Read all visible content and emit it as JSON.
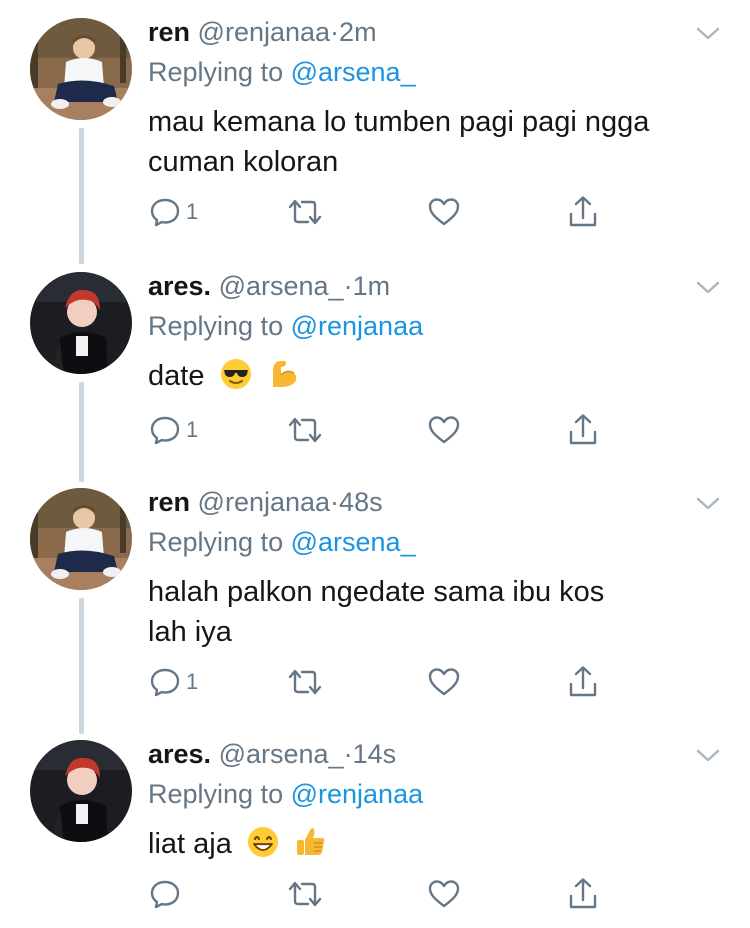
{
  "tweets": [
    {
      "name": "ren",
      "handle": "@renjanaa",
      "separator": "·",
      "time": "2m",
      "replying_prefix": "Replying to",
      "replying_handle": "@arsena_",
      "lines": [
        "mau kemana lo tumben pagi pagi ngga",
        "cuman koloran"
      ],
      "emojis": [],
      "reply_count": "1"
    },
    {
      "name": "ares.",
      "handle": "@arsena_",
      "separator": "·",
      "time": "1m",
      "replying_prefix": "Replying to",
      "replying_handle": "@renjanaa",
      "lines": [
        "date"
      ],
      "emojis": [
        "😎",
        "💪"
      ],
      "reply_count": "1"
    },
    {
      "name": "ren",
      "handle": "@renjanaa",
      "separator": "·",
      "time": "48s",
      "replying_prefix": "Replying to",
      "replying_handle": "@arsena_",
      "lines": [
        "halah palkon ngedate sama ibu kos",
        "lah iya"
      ],
      "emojis": [],
      "reply_count": "1"
    },
    {
      "name": "ares.",
      "handle": "@arsena_",
      "separator": "·",
      "time": "14s",
      "replying_prefix": "Replying to",
      "replying_handle": "@renjanaa",
      "lines": [
        "liat aja"
      ],
      "emojis": [
        "😁",
        "👍"
      ],
      "reply_count": ""
    }
  ],
  "colors": {
    "text": "#14171a",
    "secondary": "#657786",
    "link": "#1b95e0",
    "thread_line": "#ccd6dd"
  },
  "icons": [
    "reply-icon",
    "retweet-icon",
    "like-icon",
    "share-icon",
    "caret-down-icon"
  ]
}
